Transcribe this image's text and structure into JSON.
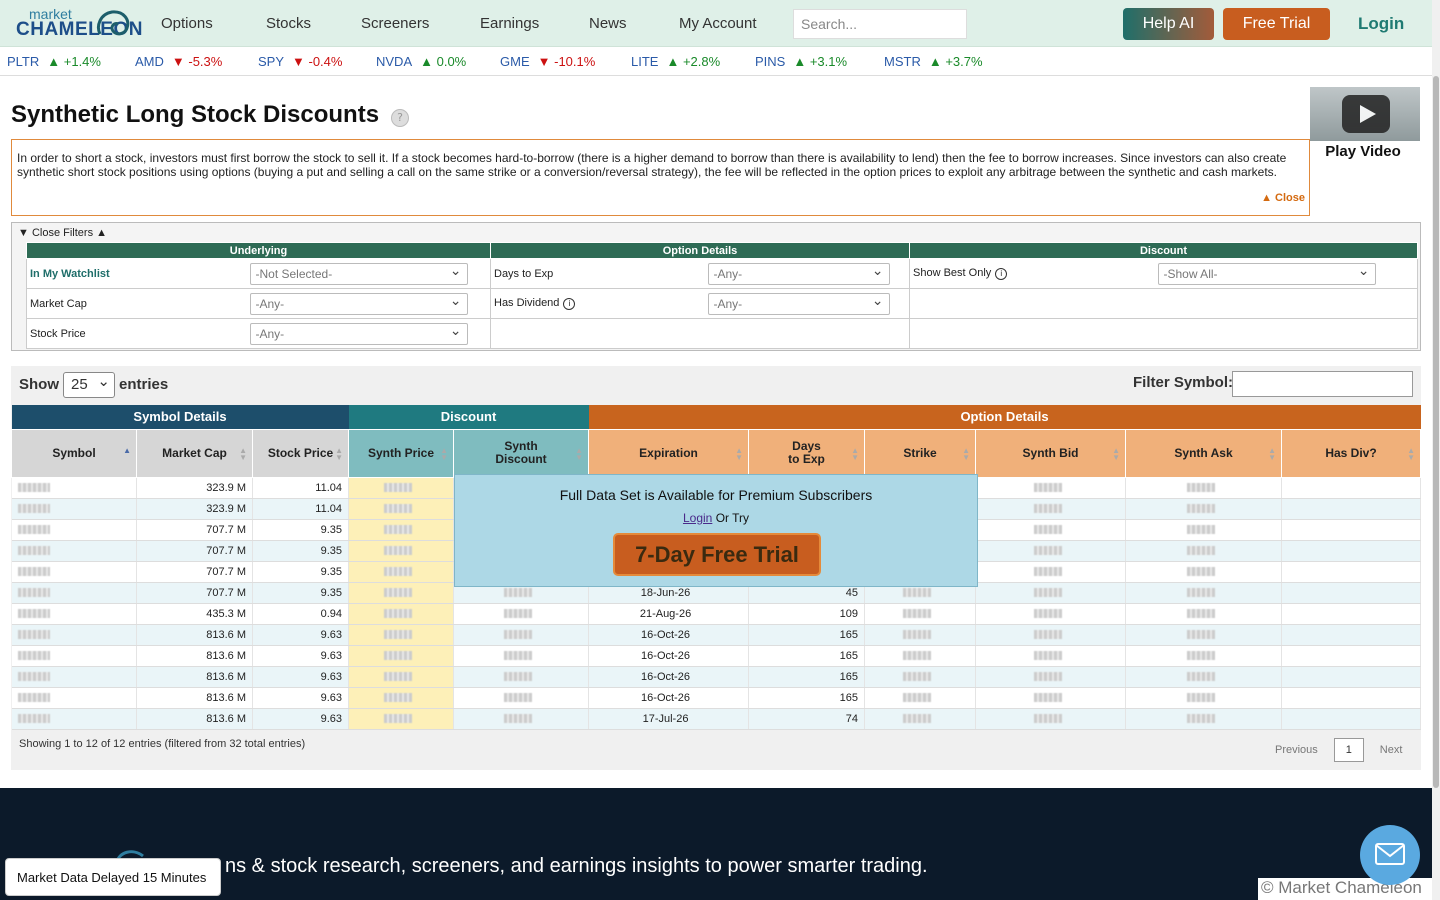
{
  "nav": {
    "logo_top": "market",
    "logo_bottom": "CHAMELEON",
    "items": [
      "Options",
      "Stocks",
      "Screeners",
      "Earnings",
      "News",
      "My Account"
    ],
    "search_placeholder": "Search...",
    "help_ai": "Help AI",
    "free_trial": "Free Trial",
    "login": "Login"
  },
  "ticker": [
    {
      "symbol": "PLTR",
      "change": "+1.4%",
      "dir": "up"
    },
    {
      "symbol": "AMD",
      "change": "-5.3%",
      "dir": "down"
    },
    {
      "symbol": "SPY",
      "change": "-0.4%",
      "dir": "down"
    },
    {
      "symbol": "NVDA",
      "change": "0.0%",
      "dir": "up"
    },
    {
      "symbol": "GME",
      "change": "-10.1%",
      "dir": "down"
    },
    {
      "symbol": "LITE",
      "change": "+2.8%",
      "dir": "up"
    },
    {
      "symbol": "PINS",
      "change": "+3.1%",
      "dir": "up"
    },
    {
      "symbol": "MSTR",
      "change": "+3.7%",
      "dir": "up"
    }
  ],
  "page": {
    "title": "Synthetic Long Stock Discounts",
    "help_icon": "?",
    "video_label": "Play Video",
    "description": "In order to short a stock, investors must first borrow the stock to sell it. If a stock becomes hard-to-borrow (there is a higher demand to borrow than there is availability to lend) then the fee to borrow increases. Since investors can also create synthetic short stock positions using options (buying a put and selling a call on the same strike or a conversion/reversal strategy), the fee will be reflected in the option prices to exploit any arbitrage between the synthetic and cash markets.",
    "desc_close": "▲ Close"
  },
  "filters": {
    "toggle": "Close Filters",
    "groups": [
      "Underlying",
      "Option Details",
      "Discount"
    ],
    "watchlist_label": "In My Watchlist",
    "watchlist_value": "-Not Selected-",
    "marketcap_label": "Market Cap",
    "marketcap_value": "-Any-",
    "stockprice_label": "Stock Price",
    "stockprice_value": "-Any-",
    "days_label": "Days to Exp",
    "days_value": "-Any-",
    "dividend_label": "Has Dividend",
    "dividend_value": "-Any-",
    "best_label": "Show Best Only",
    "best_value": "-Show All-"
  },
  "table": {
    "show_label": "Show",
    "show_value": "25",
    "entries_label": "entries",
    "filter_symbol_label": "Filter Symbol:",
    "groups": [
      "Symbol Details",
      "Discount",
      "Option Details"
    ],
    "columns": [
      "Symbol",
      "Market Cap",
      "Stock Price",
      "Synth Price",
      "Synth Discount",
      "Expiration",
      "Days to Exp",
      "Strike",
      "Synth Bid",
      "Synth Ask",
      "Has Div?"
    ],
    "rows": [
      {
        "cap": "323.9 M",
        "price": "11.04",
        "exp": "",
        "days": ""
      },
      {
        "cap": "323.9 M",
        "price": "11.04",
        "exp": "",
        "days": ""
      },
      {
        "cap": "707.7 M",
        "price": "9.35",
        "exp": "",
        "days": ""
      },
      {
        "cap": "707.7 M",
        "price": "9.35",
        "exp": "",
        "days": ""
      },
      {
        "cap": "707.7 M",
        "price": "9.35",
        "exp": "",
        "days": ""
      },
      {
        "cap": "707.7 M",
        "price": "9.35",
        "exp": "18-Jun-26",
        "days": "45"
      },
      {
        "cap": "435.3 M",
        "price": "0.94",
        "exp": "21-Aug-26",
        "days": "109"
      },
      {
        "cap": "813.6 M",
        "price": "9.63",
        "exp": "16-Oct-26",
        "days": "165"
      },
      {
        "cap": "813.6 M",
        "price": "9.63",
        "exp": "16-Oct-26",
        "days": "165"
      },
      {
        "cap": "813.6 M",
        "price": "9.63",
        "exp": "16-Oct-26",
        "days": "165"
      },
      {
        "cap": "813.6 M",
        "price": "9.63",
        "exp": "16-Oct-26",
        "days": "165"
      },
      {
        "cap": "813.6 M",
        "price": "9.63",
        "exp": "17-Jul-26",
        "days": "74"
      }
    ],
    "info": "Showing 1 to 12 of 12 entries (filtered from 32 total entries)",
    "prev": "Previous",
    "page": "1",
    "next": "Next"
  },
  "modal": {
    "title": "Full Data Set is Available for Premium Subscribers",
    "login": "Login",
    "or_try": "Or Try",
    "button": "7-Day Free Trial"
  },
  "footer": {
    "tagline": "ns & stock research, screeners, and earnings insights to power smarter trading.",
    "copyright": "© Market Chameleon",
    "delay": "Market Data Delayed 15 Minutes"
  },
  "colors": {
    "nav_bg": "#dff0e8",
    "symbol_group": "#1d4e6b",
    "discount_group": "#1f7a80",
    "option_group": "#c8641e",
    "trial": "#c85d1f"
  }
}
